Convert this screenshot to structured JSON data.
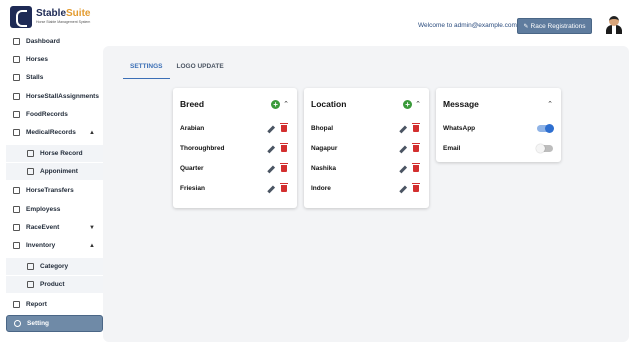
{
  "header": {
    "logo_title_a": "Stable",
    "logo_title_b": "Suite",
    "logo_subtitle": "Horse Stable Management System",
    "welcome": "Welcome to admin@example.com",
    "race_button": "Race Registrations"
  },
  "sidebar": {
    "items": [
      {
        "label": "Dashboard"
      },
      {
        "label": "Horses"
      },
      {
        "label": "Stalls"
      },
      {
        "label": "HorseStallAssignments"
      },
      {
        "label": "FoodRecords"
      },
      {
        "label": "MedicalRecords"
      },
      {
        "label": "Horse Record"
      },
      {
        "label": "Apponiment"
      },
      {
        "label": "HorseTransfers"
      },
      {
        "label": "Employess"
      },
      {
        "label": "RaceEvent"
      },
      {
        "label": "Inventory"
      },
      {
        "label": "Category"
      },
      {
        "label": "Product"
      },
      {
        "label": "Report"
      },
      {
        "label": "Setting"
      }
    ]
  },
  "tabs": [
    {
      "label": "SETTINGS"
    },
    {
      "label": "LOGO UPDATE"
    }
  ],
  "breed_card": {
    "title": "Breed",
    "items": [
      "Arabian",
      "Thoroughbred",
      "Quarter",
      "Friesian"
    ]
  },
  "location_card": {
    "title": "Location",
    "items": [
      "Bhopal",
      "Nagapur",
      "Nashika",
      "Indore"
    ]
  },
  "message_card": {
    "title": "Message",
    "options": [
      {
        "label": "WhatsApp",
        "enabled": true
      },
      {
        "label": "Email",
        "enabled": false
      }
    ]
  },
  "colors": {
    "accent": "#3b6fb6",
    "active_sidebar": "#6f8aa7",
    "add_green": "#3a9a3a",
    "delete_red": "#d32f2f",
    "toggle_on": "#2e6fd0"
  }
}
